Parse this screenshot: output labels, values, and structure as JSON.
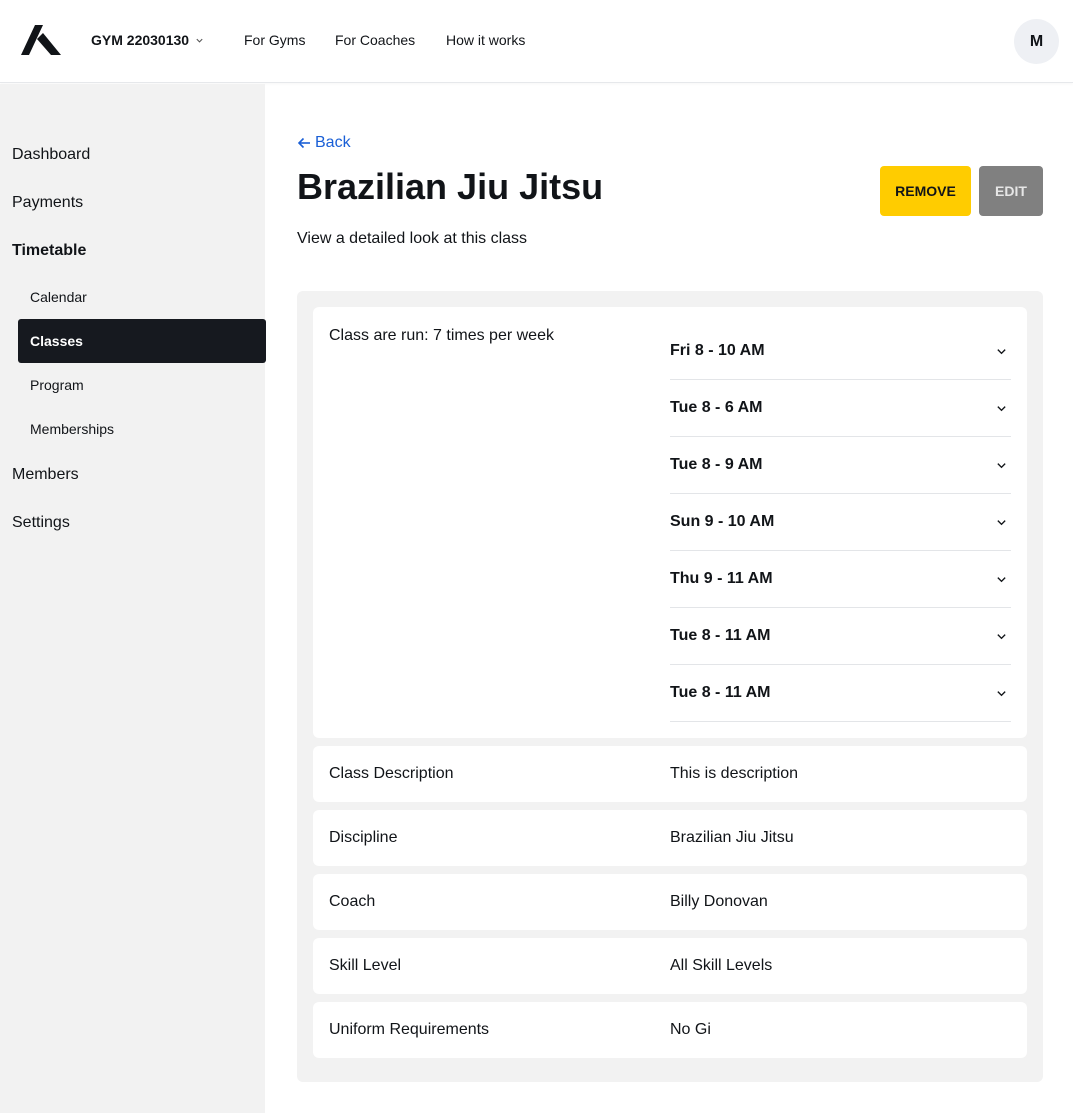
{
  "header": {
    "gym_name": "GYM 22030130",
    "nav_links": [
      "For Gyms",
      "For Coaches",
      "How it works"
    ],
    "avatar_initial": "M"
  },
  "sidebar": {
    "items": [
      {
        "label": "Dashboard"
      },
      {
        "label": "Payments"
      },
      {
        "label": "Timetable"
      },
      {
        "label": "Calendar"
      },
      {
        "label": "Classes"
      },
      {
        "label": "Program"
      },
      {
        "label": "Memberships"
      },
      {
        "label": "Members"
      },
      {
        "label": "Settings"
      }
    ],
    "active": "Classes"
  },
  "page": {
    "back_label": "Back",
    "title": "Brazilian Jiu Jitsu",
    "subtitle": "View a detailed look at this class",
    "remove_label": "REMOVE",
    "edit_label": "EDIT"
  },
  "schedule": {
    "label": "Class are run: 7 times per week",
    "sessions": [
      "Fri 8 - 10 AM",
      "Tue 8 - 6 AM",
      "Tue 8 - 9 AM",
      "Sun 9 - 10 AM",
      "Thu 9 - 11 AM",
      "Tue 8 - 11 AM",
      "Tue 8 - 11 AM"
    ]
  },
  "details": [
    {
      "label": "Class Description",
      "value": "This is description"
    },
    {
      "label": "Discipline",
      "value": "Brazilian Jiu Jitsu"
    },
    {
      "label": "Coach",
      "value": "Billy Donovan"
    },
    {
      "label": "Skill Level",
      "value": "All Skill Levels"
    },
    {
      "label": "Uniform Requirements",
      "value": "No Gi"
    }
  ],
  "colors": {
    "accent_link": "#1a5fd6",
    "remove_button": "#ffcc00",
    "edit_button": "#808080",
    "active_nav": "#16191f"
  },
  "icons": [
    "logo-icon",
    "chevron-down-icon",
    "arrow-left-icon"
  ]
}
